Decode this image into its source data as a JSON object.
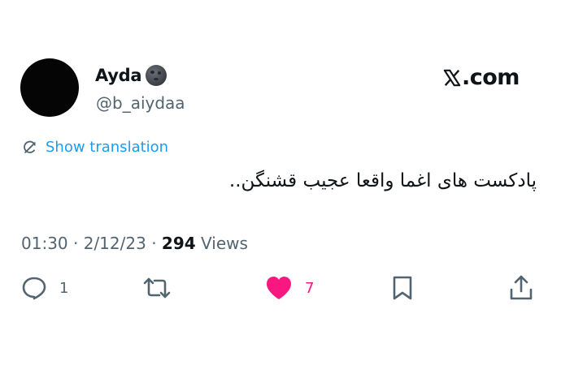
{
  "author": {
    "name": "Ayda",
    "handle": "@b_aiydaa"
  },
  "brand": {
    "suffix": ".com"
  },
  "translation": {
    "label": "Show translation"
  },
  "tweet": {
    "text": "پادکست های اغما واقعا عجیب قشنگن.."
  },
  "meta": {
    "time": "01:30",
    "date": "2/12/23",
    "views_count": "294",
    "views_label": "Views"
  },
  "actions": {
    "replies": "1",
    "likes": "7"
  },
  "colors": {
    "accent": "#1d9bf0",
    "like": "#f91880",
    "muted": "#536471",
    "text": "#0f1419"
  },
  "icons": [
    "new-moon-face-emoji",
    "x-logo-icon",
    "translate-icon",
    "reply-icon",
    "retweet-icon",
    "heart-icon",
    "bookmark-icon",
    "share-icon"
  ]
}
